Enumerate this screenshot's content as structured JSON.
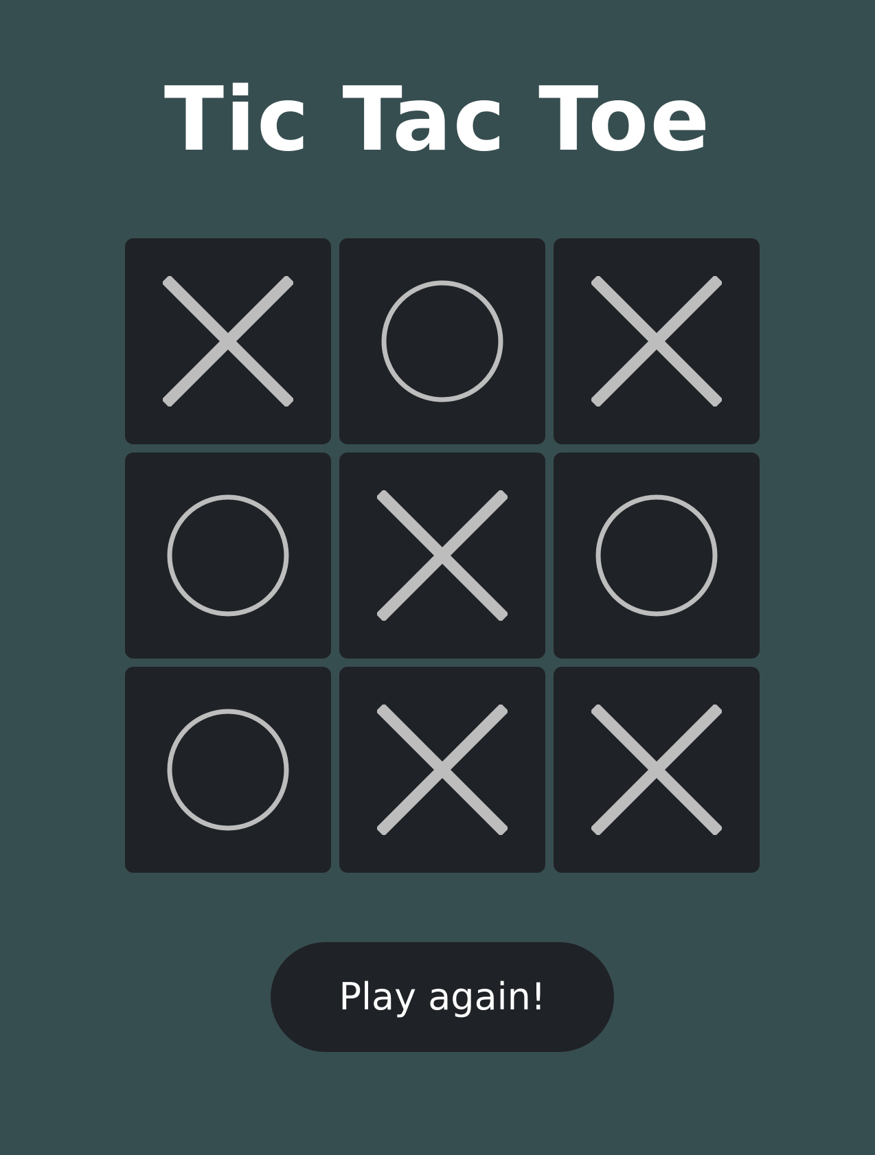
{
  "title": "Tic Tac Toe",
  "board": {
    "cells": [
      "X",
      "O",
      "X",
      "O",
      "X",
      "O",
      "O",
      "X",
      "X"
    ]
  },
  "play_again_label": "Play again!",
  "colors": {
    "background": "#374e50",
    "cell": "#1f2226",
    "mark": "#bdbdbd",
    "text": "#ffffff"
  }
}
